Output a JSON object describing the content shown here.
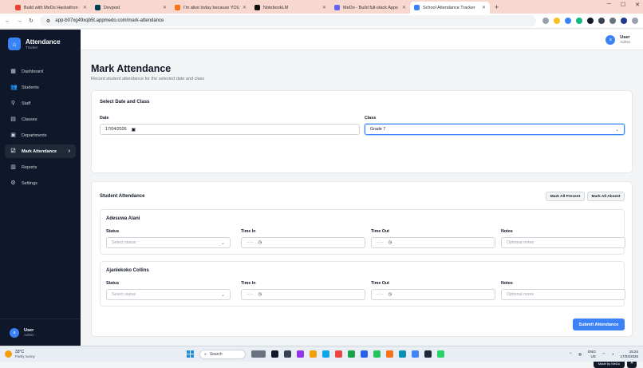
{
  "browser": {
    "tabs": [
      {
        "label": "Build with MeDo Hackathon - ",
        "color": "#ea4335",
        "active": false
      },
      {
        "label": "Devpost",
        "color": "#003e54",
        "active": false
      },
      {
        "label": "I'm alive today because YOU'",
        "color": "#f97316",
        "active": false
      },
      {
        "label": "NotebookLM",
        "color": "#111111",
        "active": false
      },
      {
        "label": "MeDo - Build full-stack Apps W",
        "color": "#6366f1",
        "active": false
      },
      {
        "label": "School Attendance Tracker",
        "color": "#3b82f6",
        "active": true
      }
    ],
    "url": "app-b07xg49xqb5t.appmedo.com/mark-attendance"
  },
  "sidebar": {
    "brand_title": "Attendance",
    "brand_sub": "Tracker",
    "items": [
      {
        "label": "Dashboard",
        "icon": "dashboard-icon",
        "glyph": "▦"
      },
      {
        "label": "Students",
        "icon": "users-icon",
        "glyph": "👥"
      },
      {
        "label": "Staff",
        "icon": "staff-icon",
        "glyph": "⚲"
      },
      {
        "label": "Classes",
        "icon": "book-icon",
        "glyph": "▤"
      },
      {
        "label": "Departments",
        "icon": "building-icon",
        "glyph": "▣"
      },
      {
        "label": "Mark Attendance",
        "icon": "clipboard-icon",
        "glyph": "☑"
      },
      {
        "label": "Reports",
        "icon": "chart-icon",
        "glyph": "▥"
      },
      {
        "label": "Settings",
        "icon": "gear-icon",
        "glyph": "⚙"
      }
    ],
    "user_initial": "a",
    "user_name": "User",
    "user_role": "Admin"
  },
  "topbar": {
    "user_initial": "a",
    "user_name": "User",
    "user_role": "Admin"
  },
  "page": {
    "title": "Mark Attendance",
    "subtitle": "Record student attendance for the selected date and class"
  },
  "select_card": {
    "title": "Select Date and Class",
    "date_label": "Date",
    "date_value": "17/04/2026",
    "class_label": "Class",
    "class_value": "Grade 7"
  },
  "attendance_card": {
    "title": "Student Attendance",
    "mark_all_present": "Mark All Present",
    "mark_all_absent": "Mark All Absent",
    "status_label": "Status",
    "time_in_label": "Time In",
    "time_out_label": "Time Out",
    "notes_label": "Notes",
    "status_placeholder": "Select status",
    "time_placeholder": "--:--",
    "notes_placeholder": "Optional notes",
    "students": [
      "Adesuwa Alani",
      "Ajanlekoko Collins"
    ],
    "submit": "Submit Attendance"
  },
  "made_by": "Made by MeDo",
  "taskbar": {
    "temp": "33°C",
    "weather": "Partly sunny",
    "search": "Search",
    "lang1": "ENG",
    "lang2": "US",
    "time": "15:24",
    "date": "17/04/2026"
  }
}
